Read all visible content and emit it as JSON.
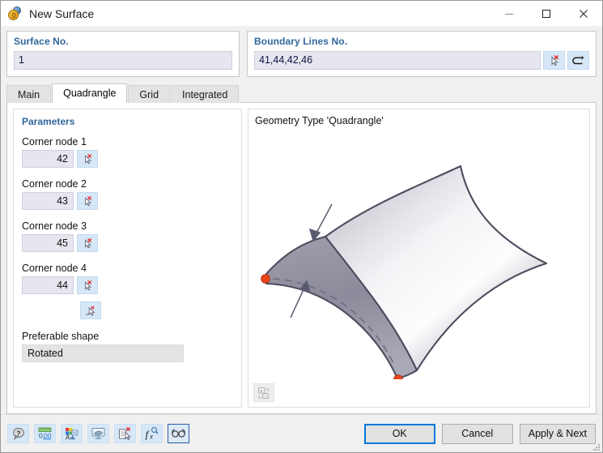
{
  "window": {
    "title": "New Surface",
    "icon": "surface-icon",
    "controls": {
      "minimize": "minimize-icon",
      "maximize": "maximize-icon",
      "close": "close-icon"
    }
  },
  "surface_group": {
    "title": "Surface No.",
    "value": "1"
  },
  "boundary_group": {
    "title": "Boundary Lines No.",
    "value": "41,44,42,46",
    "pick_button": "pick-cursor-icon",
    "undo_button": "undo-arrow-icon"
  },
  "tabs": [
    {
      "label": "Main",
      "active": false
    },
    {
      "label": "Quadrangle",
      "active": true
    },
    {
      "label": "Grid",
      "active": false
    },
    {
      "label": "Integrated",
      "active": false
    }
  ],
  "parameters": {
    "title": "Parameters",
    "nodes": [
      {
        "label": "Corner node 1",
        "value": "42",
        "pick_icon": "pick-cursor-icon"
      },
      {
        "label": "Corner node 2",
        "value": "43",
        "pick_icon": "pick-cursor-icon"
      },
      {
        "label": "Corner node 3",
        "value": "45",
        "pick_icon": "pick-cursor-icon"
      },
      {
        "label": "Corner node 4",
        "value": "44",
        "pick_icon": "pick-cursor-icon"
      }
    ],
    "extra_pick_icon": "pick-multiple-nodes-icon",
    "preferable_shape": {
      "label": "Preferable shape",
      "value": "Rotated"
    }
  },
  "preview": {
    "title": "Geometry Type 'Quadrangle'",
    "settings_icon": "preview-settings-icon",
    "colors": {
      "surface_light": "#fbfbfc",
      "surface_dark": "#8a8a99",
      "outline": "#4a4a5e",
      "node_marker": "#e8441a"
    }
  },
  "footer": {
    "toolbar": [
      {
        "name": "help-icon",
        "selected": false
      },
      {
        "name": "units-decimals-icon",
        "selected": false
      },
      {
        "name": "display-properties-icon",
        "selected": false
      },
      {
        "name": "view-mode-icon",
        "selected": false
      },
      {
        "name": "clear-details-icon",
        "selected": false
      },
      {
        "name": "formula-icon",
        "selected": false
      },
      {
        "name": "visibility-glasses-icon",
        "selected": true
      }
    ],
    "buttons": {
      "ok": "OK",
      "cancel": "Cancel",
      "apply_next": "Apply & Next"
    }
  }
}
